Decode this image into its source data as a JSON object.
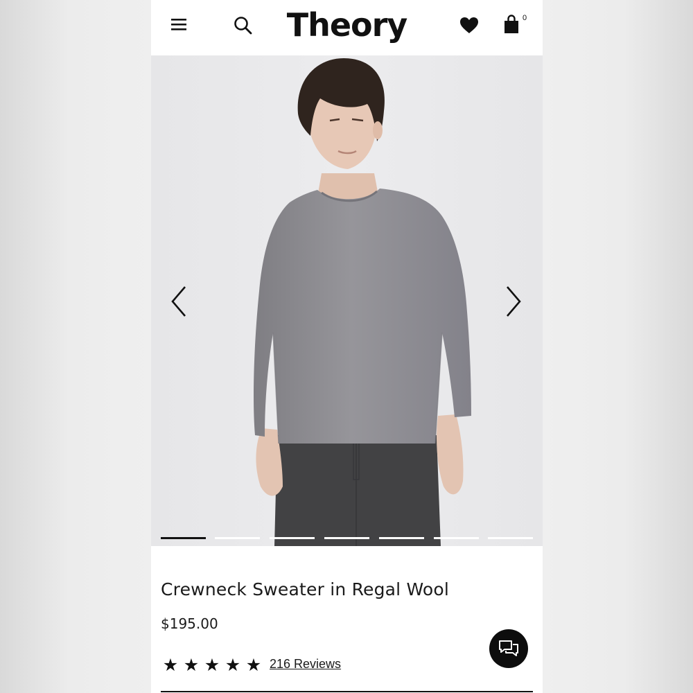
{
  "header": {
    "logo": "Theory",
    "bag_count": "0",
    "icons": {
      "menu": "hamburger-menu-icon",
      "search": "search-icon",
      "favorites": "heart-icon",
      "bag": "shopping-bag-icon"
    }
  },
  "gallery": {
    "image": "gray-crewneck-sweater-model-photo",
    "slide_count": 7,
    "active_slide": 1,
    "prev_icon": "chevron-left-icon",
    "next_icon": "chevron-right-icon"
  },
  "product": {
    "title": "Crewneck Sweater in Regal Wool",
    "price": "$195.00",
    "rating_stars": 5,
    "star_glyph": "★",
    "reviews_label": "216 Reviews"
  },
  "chat": {
    "icon": "chat-bubbles-icon"
  },
  "colors": {
    "text": "#1a1a1a",
    "accent": "#111111",
    "sweater": "#8f8e93",
    "pants": "#424244"
  }
}
